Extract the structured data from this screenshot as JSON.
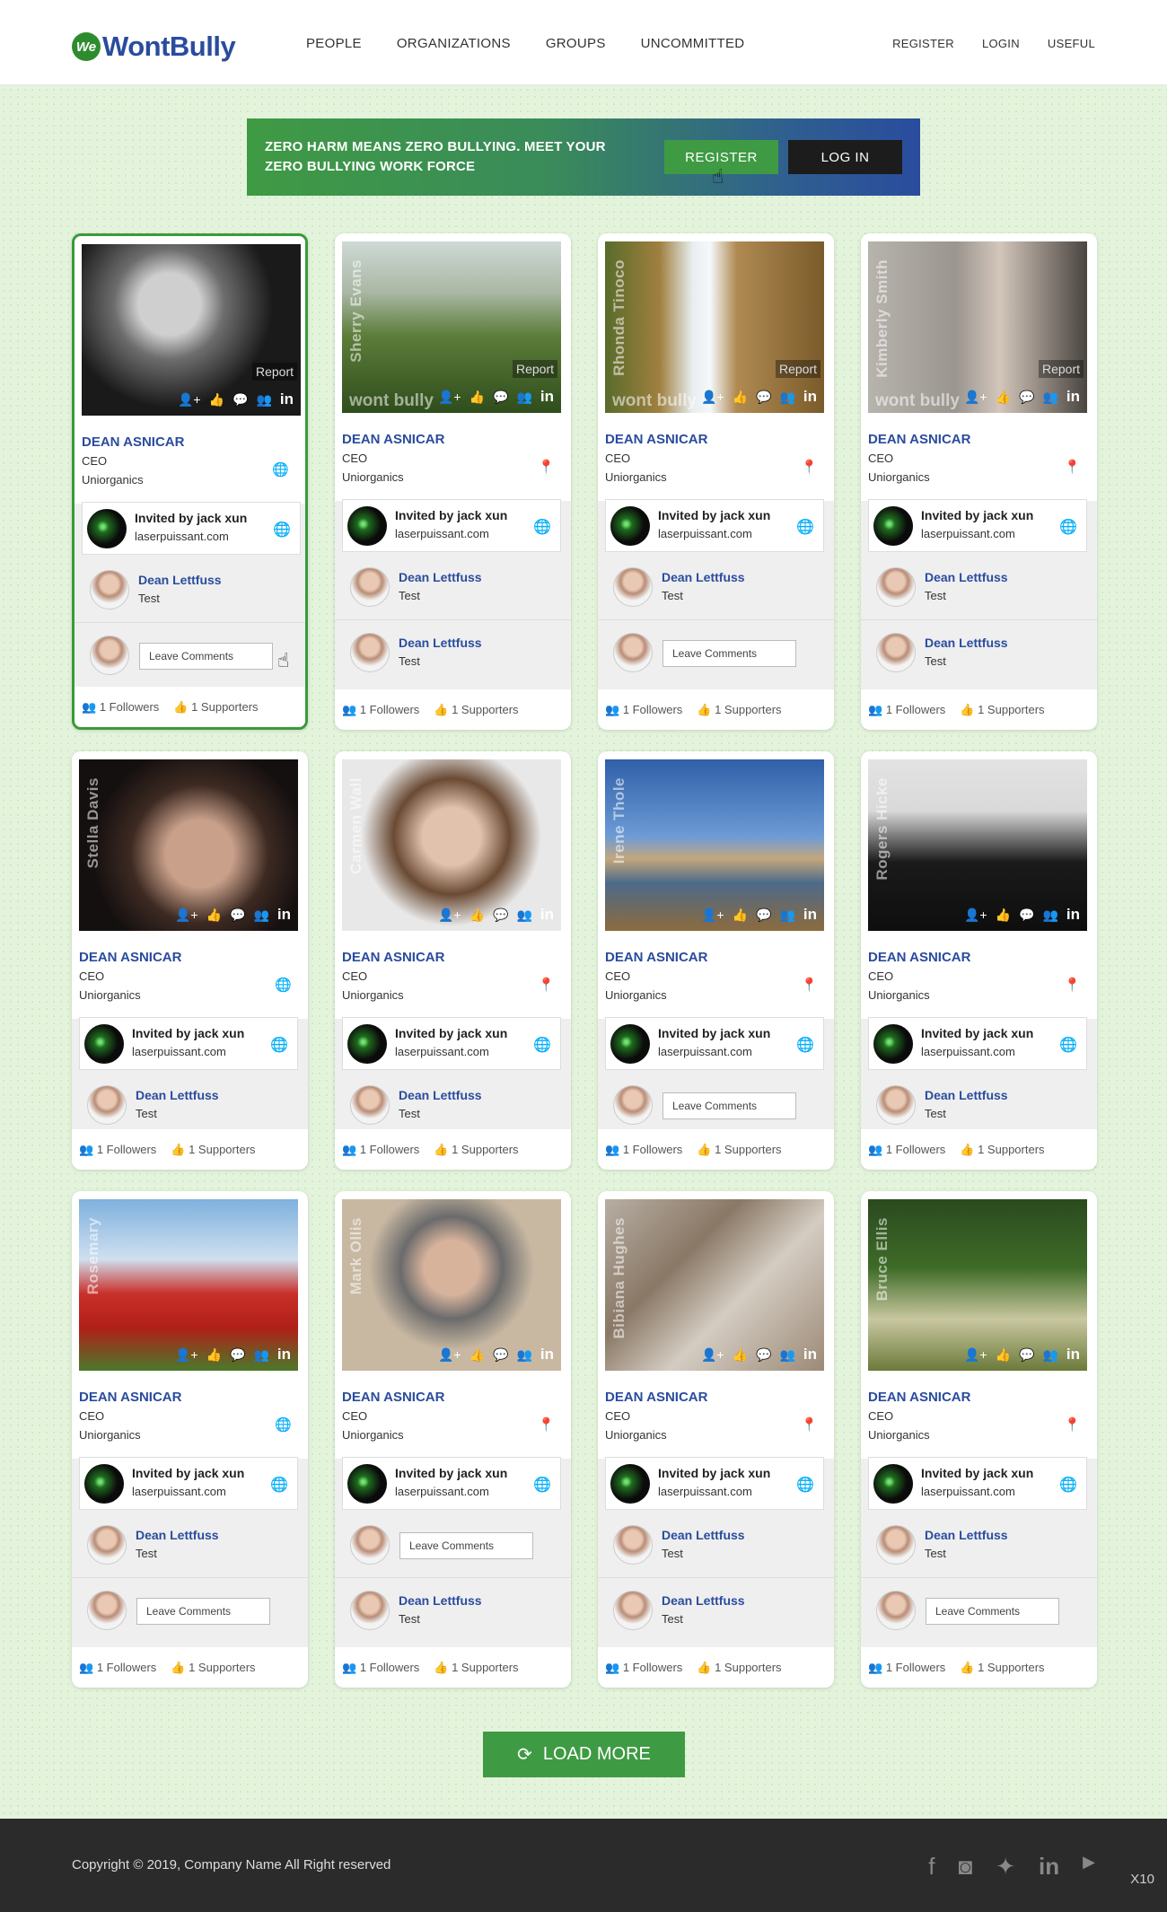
{
  "header": {
    "logo_badge": "We",
    "logo_text": "WontBully",
    "nav": [
      "PEOPLE",
      "ORGANIZATIONS",
      "GROUPS",
      "UNCOMMITTED"
    ],
    "nav_right": [
      "REGISTER",
      "LOGIN",
      "USEFUL"
    ]
  },
  "banner": {
    "text": "ZERO HARM MEANS ZERO BULLYING. MEET YOUR ZERO BULLYING WORK FORCE",
    "register_label": "REGISTER",
    "login_label": "LOG IN"
  },
  "common": {
    "name": "DEAN ASNICAR",
    "title": "CEO",
    "org": "Uniorganics",
    "invite_line1": "Invited by jack xun",
    "invite_line2": "laserpuissant.com",
    "supporter_name": "Dean Lettfuss",
    "supporter_sub": "Test",
    "leave_comments": "Leave Comments",
    "followers": "1 Followers",
    "supporters": "1 Supporters",
    "report": "Report",
    "watermark": "wont bully"
  },
  "cards": [
    {
      "vname": "",
      "report": true,
      "wm": false,
      "loc_icon": "globe",
      "rows": [
        "person",
        "comment"
      ],
      "selected": true,
      "photo": "bw-man"
    },
    {
      "vname": "Sherry Evans",
      "report": true,
      "wm": true,
      "loc_icon": "pin",
      "rows": [
        "person",
        "person"
      ],
      "selected": false,
      "photo": "tropical"
    },
    {
      "vname": "Rhonda Tinoco",
      "report": true,
      "wm": true,
      "loc_icon": "pin",
      "rows": [
        "person",
        "comment"
      ],
      "selected": false,
      "photo": "waterfall"
    },
    {
      "vname": "Kimberly Smith",
      "report": true,
      "wm": true,
      "loc_icon": "pin",
      "rows": [
        "person",
        "person"
      ],
      "selected": false,
      "photo": "glasses-man"
    },
    {
      "vname": "Stella Davis",
      "report": false,
      "wm": false,
      "loc_icon": "globe",
      "rows": [
        "person"
      ],
      "selected": false,
      "photo": "woman-flowers"
    },
    {
      "vname": "Carmen Wall",
      "report": false,
      "wm": false,
      "loc_icon": "pin",
      "rows": [
        "person"
      ],
      "selected": false,
      "photo": "sunglasses"
    },
    {
      "vname": "Irene Thole",
      "report": false,
      "wm": false,
      "loc_icon": "pin",
      "rows": [
        "comment"
      ],
      "selected": false,
      "photo": "lake"
    },
    {
      "vname": "Rogers Hicke",
      "report": false,
      "wm": false,
      "loc_icon": "pin",
      "rows": [
        "person"
      ],
      "selected": false,
      "photo": "jacket-man"
    },
    {
      "vname": "Rosemary",
      "report": false,
      "wm": false,
      "loc_icon": "globe",
      "rows": [
        "person",
        "comment"
      ],
      "selected": false,
      "photo": "poppies"
    },
    {
      "vname": "Mark Ollis",
      "report": false,
      "wm": false,
      "loc_icon": "pin",
      "rows": [
        "comment",
        "person"
      ],
      "selected": false,
      "photo": "suit-man"
    },
    {
      "vname": "Bibiana Hughes",
      "report": false,
      "wm": false,
      "loc_icon": "pin",
      "rows": [
        "person",
        "person"
      ],
      "selected": false,
      "photo": "violin"
    },
    {
      "vname": "Bruce Ellis",
      "report": false,
      "wm": false,
      "loc_icon": "pin",
      "rows": [
        "person",
        "comment"
      ],
      "selected": false,
      "photo": "tree"
    }
  ],
  "load_more": "LOAD MORE",
  "footer": {
    "copyright": "Copyright © 2019, Company Name All Right reserved",
    "socials": [
      "facebook-icon",
      "instagram-icon",
      "twitter-icon",
      "linkedin-icon",
      "youtube-icon"
    ],
    "zoom": "X10"
  }
}
